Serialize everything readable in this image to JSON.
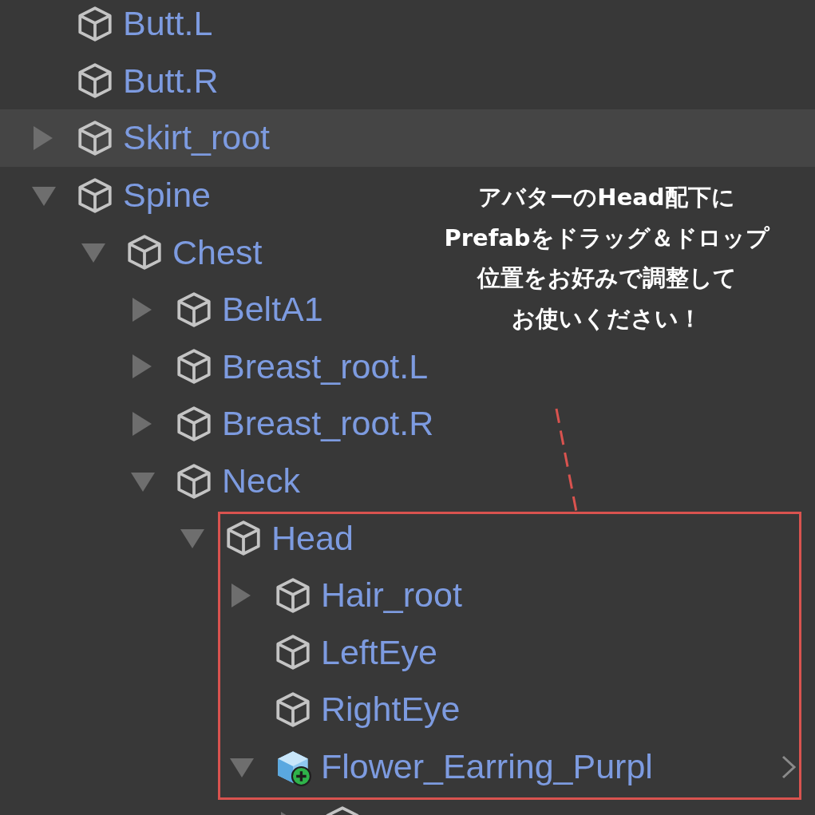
{
  "tree": [
    {
      "label": "Butt.L",
      "kind": "object",
      "highlighted": false
    },
    {
      "label": "Butt.R",
      "kind": "object",
      "highlighted": false
    },
    {
      "label": "Skirt_root",
      "kind": "object",
      "expanded": false,
      "highlighted": true
    },
    {
      "label": "Spine",
      "kind": "object",
      "expanded": true,
      "highlighted": false,
      "children": [
        {
          "label": "Chest",
          "kind": "object",
          "expanded": true,
          "highlighted": false,
          "children": [
            {
              "label": "BeltA1",
              "kind": "object",
              "expanded": false,
              "highlighted": false
            },
            {
              "label": "Breast_root.L",
              "kind": "object",
              "expanded": false,
              "highlighted": false
            },
            {
              "label": "Breast_root.R",
              "kind": "object",
              "expanded": false,
              "highlighted": false
            },
            {
              "label": "Neck",
              "kind": "object",
              "expanded": true,
              "highlighted": false,
              "children": [
                {
                  "label": "Head",
                  "kind": "object",
                  "expanded": true,
                  "highlighted": false,
                  "children": [
                    {
                      "label": "Hair_root",
                      "kind": "object",
                      "expanded": false,
                      "highlighted": false
                    },
                    {
                      "label": "LeftEye",
                      "kind": "object",
                      "highlighted": false
                    },
                    {
                      "label": "RightEye",
                      "kind": "object",
                      "highlighted": false
                    },
                    {
                      "label": "Flower_Earring_Purpl",
                      "kind": "prefab_added",
                      "expanded": true,
                      "highlighted": false,
                      "children": [
                        {
                          "kind": "object",
                          "expanded": false,
                          "highlighted": false
                        }
                      ]
                    }
                  ]
                }
              ]
            }
          ]
        }
      ]
    }
  ],
  "annotation": {
    "lines": [
      "アバターのHead配下に",
      "Prefabをドラッグ＆ドロップ",
      "位置をお好みで調整して",
      "お使いください！"
    ]
  }
}
